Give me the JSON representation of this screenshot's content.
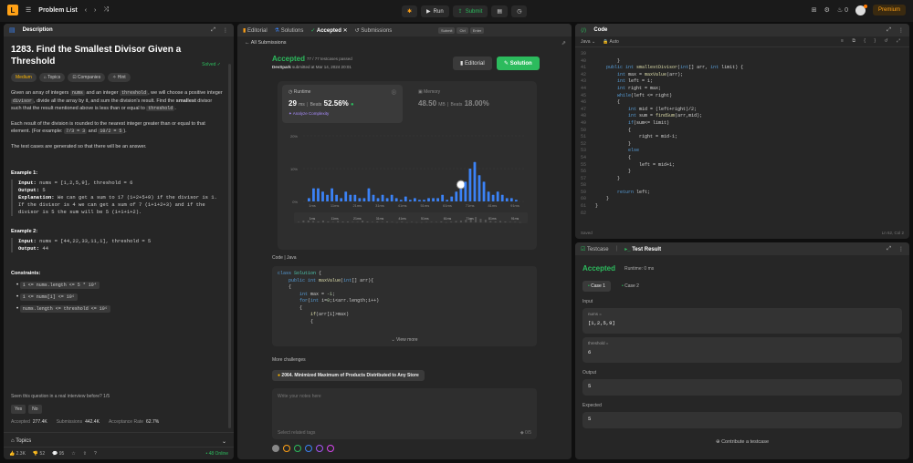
{
  "topbar": {
    "logo": "L",
    "problem_list": "Problem List",
    "prev": "‹",
    "next": "›",
    "shuffle": "⤨",
    "run": "Run",
    "submit": "Submit",
    "streak": "0",
    "premium": "Premium"
  },
  "description": {
    "tab": "Description",
    "title": "1283. Find the Smallest Divisor Given a Threshold",
    "solved": "Solved ✓",
    "tags": [
      "Medium",
      "Topics",
      "Companies",
      "Hint"
    ],
    "p1_a": "Given an array of integers ",
    "p1_nums": "nums",
    "p1_b": " and an integer ",
    "p1_thr": "threshold",
    "p1_c": ", we will choose a positive integer ",
    "p1_div": "divisor",
    "p1_d": ", divide all the array by it, and sum the division's result. Find the ",
    "p1_smallest": "smallest",
    "p1_e": " divisor such that the result mentioned above is less than or equal to ",
    "p1_thr2": "threshold",
    "p1_f": ".",
    "p2_a": "Each result of the division is rounded to the nearest integer greater than or equal to that element. (For example: ",
    "p2_c1": "7/3 = 3",
    "p2_and": " and ",
    "p2_c2": "10/2 = 5",
    "p2_b": ").",
    "p3": "The test cases are generated so that there will be an answer.",
    "ex1_title": "Example 1:",
    "ex1_input_label": "Input:",
    "ex1_input": " nums = [1,2,5,9], threshold = 6",
    "ex1_output_label": "Output:",
    "ex1_output": " 5",
    "ex1_expl_label": "Explanation:",
    "ex1_expl": " We can get a sum to 17 (1+2+5+9) if the divisor is 1.",
    "ex1_expl2": "If the divisor is 4 we can get a sum of 7 (1+1+2+3) and if the divisor is 5 the sum will be 5 (1+1+1+2).",
    "ex2_title": "Example 2:",
    "ex2_input_label": "Input:",
    "ex2_input": " nums = [44,22,33,11,1], threshold = 5",
    "ex2_output_label": "Output:",
    "ex2_output": " 44",
    "cons_title": "Constraints:",
    "cons": [
      "1 <= nums.length <= 5 * 10⁴",
      "1 <= nums[i] <= 10⁶",
      "nums.length <= threshold <= 10⁶"
    ],
    "seen": "Seen this question in a real interview before?   1/5",
    "yes": "Yes",
    "no": "No",
    "accepted_label": "Accepted",
    "accepted_val": "277.4K",
    "submissions_label": "Submissions",
    "submissions_val": "442.4K",
    "rate_label": "Acceptance Rate",
    "rate_val": "62.7%",
    "topics": "Topics",
    "likes": "2.3K",
    "dislikes": "52",
    "comments": "95",
    "online": "• 48 Online"
  },
  "accepted": {
    "tabs": [
      "Editorial",
      "Solutions",
      "Accepted",
      "Submissions"
    ],
    "mini": [
      "Submit",
      "Ctrl",
      "Enter"
    ],
    "all_submissions": "← All Submissions",
    "title": "Accepted",
    "testcases": "77 / 77 testcases passed",
    "user": "DevSpark",
    "submitted": "submitted at Mar 14, 2024 20:01",
    "editorial_btn": "Editorial",
    "solution_btn": "Solution",
    "runtime_label": "Runtime",
    "runtime_val": "29",
    "runtime_unit": "ms",
    "beats_label": "Beats",
    "beats_val": "52.56%",
    "analyze": "Analyze Complexity",
    "memory_label": "Memory",
    "memory_val": "48.50",
    "memory_unit": "MB",
    "mem_beats_label": "Beats",
    "mem_beats_val": "18.00%",
    "code_label": "Code  |  Java",
    "view_more": "⌄ View more",
    "more_challenges": "More challenges",
    "challenge": "2064. Minimized Maximum of Products Distributed to Any Store",
    "notes_placeholder": "Write your notes here",
    "notes_tags": "Select related tags",
    "notes_count": "0/5",
    "colors": [
      "#888888",
      "#ffa116",
      "#2cbb5d",
      "#3b82f6",
      "#a855f7",
      "#d946ef"
    ]
  },
  "chart_data": {
    "type": "bar",
    "title": "",
    "xlabel": "",
    "ylabel": "",
    "y_ticks": [
      "20%",
      "10%",
      "0%"
    ],
    "x_ticks": [
      "1ms",
      "11ms",
      "21ms",
      "31ms",
      "41ms",
      "51ms",
      "61ms",
      "71ms",
      "81ms",
      "91ms"
    ],
    "ylim": [
      0,
      20
    ],
    "values": [
      1,
      4,
      4,
      3,
      2,
      4,
      2,
      1,
      3,
      2,
      2,
      1,
      1,
      4,
      2,
      1,
      2,
      1,
      2,
      1,
      0.5,
      1.5,
      0.5,
      1,
      0.5,
      0.5,
      1,
      1,
      1,
      2,
      0.5,
      1.5,
      3,
      4,
      6,
      10,
      12,
      8,
      6,
      3,
      2,
      3,
      2,
      1,
      1,
      0.5
    ],
    "highlight_index": 33,
    "bar_color": "#3b82f6",
    "highlight_color": "#ffffff"
  },
  "code_preview": {
    "lines": [
      [
        "kw:class ",
        "ty:Solution",
        " {"
      ],
      [
        "    ",
        "kw:public int ",
        "fn:maxValue",
        "(",
        "kw:int",
        "[] arr){"
      ],
      [
        "    {"
      ],
      [
        "        ",
        "kw:int ",
        "max = ",
        "nm:-1",
        ";"
      ],
      [
        "        ",
        "kw:for",
        "(",
        "kw:int ",
        "i=",
        "nm:0",
        ";i<arr.length;i++)"
      ],
      [
        "        {"
      ],
      [
        "            ",
        "fn:if",
        "(arr[i]>max)"
      ],
      [
        "            {"
      ]
    ]
  },
  "code": {
    "tab": "Code",
    "lang": "Java ⌄",
    "auto": "Auto",
    "tools": "≡ ⧉ { } ↺ ⤢",
    "foot_left": "Saved",
    "foot_right": "Ln 62, Col 2",
    "lines": [
      [
        "",
        ""
      ],
      [
        "        }"
      ],
      [
        "    ",
        "kw:public int ",
        "fn:smallestDivisor",
        "(",
        "kw:int",
        "[] arr, ",
        "kw:int ",
        "limit) {"
      ],
      [
        "        ",
        "kw:int ",
        "max = ",
        "fn:maxValue",
        "(arr);"
      ],
      [
        "        ",
        "kw:int ",
        "left = 1;"
      ],
      [
        "        ",
        "kw:int ",
        "right = max;"
      ],
      [
        "        ",
        "kw:while",
        "(left <= right)"
      ],
      [
        "        {"
      ],
      [
        "            ",
        "kw:int ",
        "mid = (left+right)/2;"
      ],
      [
        "            ",
        "kw:int ",
        "sum = ",
        "fn:findSum",
        "(arr,mid);"
      ],
      [
        "            ",
        "kw:if",
        "(sum<= limit)"
      ],
      [
        "            {"
      ],
      [
        "                right = mid-1;"
      ],
      [
        "            }"
      ],
      [
        "            ",
        "kw:else"
      ],
      [
        "            {"
      ],
      [
        "                left = mid+1;"
      ],
      [
        "            }"
      ],
      [
        "        }"
      ],
      [
        ""
      ],
      [
        "        ",
        "kw:return ",
        "left;"
      ],
      [
        "    }"
      ],
      [
        "}"
      ],
      [
        ""
      ]
    ],
    "start_line": 39
  },
  "testresult": {
    "tab1": "Testcase",
    "tab2": "Test Result",
    "status": "Accepted",
    "runtime": "Runtime: 0 ms",
    "case1": "Case 1",
    "case2": "Case 2",
    "input_label": "Input",
    "nums_label": "nums =",
    "nums_val": "[1,2,5,9]",
    "thr_label": "threshold =",
    "thr_val": "6",
    "output_label": "Output",
    "output_val": "5",
    "expected_label": "Expected",
    "expected_val": "5",
    "contribute": "⊕ Contribute a testcase"
  }
}
